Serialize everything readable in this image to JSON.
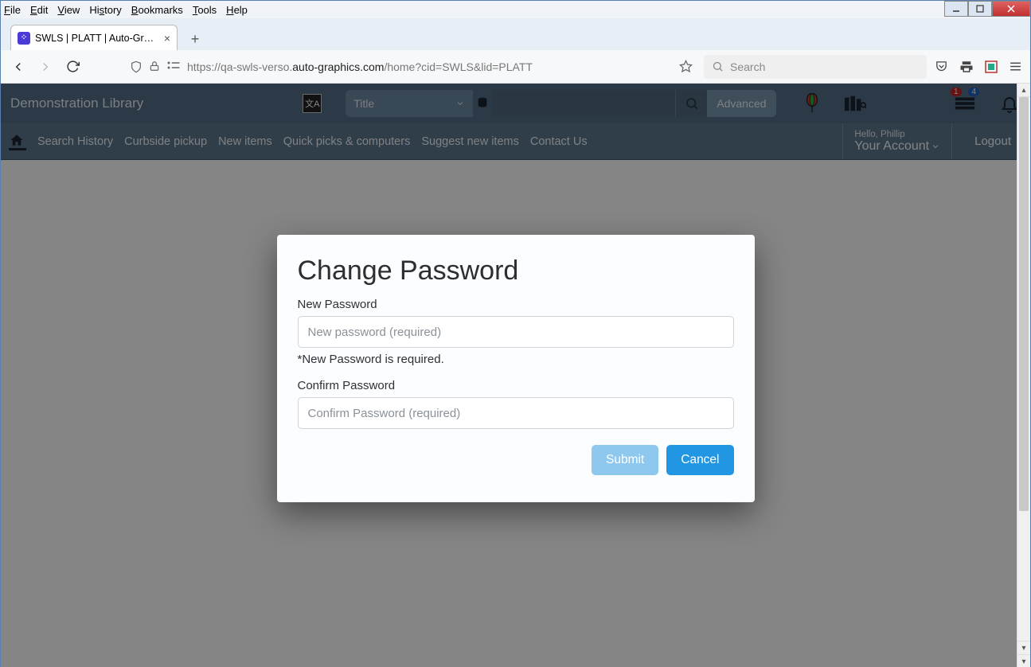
{
  "os_menu": [
    "File",
    "Edit",
    "View",
    "History",
    "Bookmarks",
    "Tools",
    "Help"
  ],
  "browser_tab": {
    "title": "SWLS | PLATT | Auto-Graphics In"
  },
  "url": {
    "prefix": "https://qa-swls-verso.",
    "domain": "auto-graphics.com",
    "path": "/home?cid=SWLS&lid=PLATT"
  },
  "browser_search_placeholder": "Search",
  "library": {
    "name": "Demonstration Library",
    "search_type": "Title",
    "advanced": "Advanced",
    "badge1": "1",
    "badge2": "4"
  },
  "nav": {
    "items": [
      "Search History",
      "Curbside pickup",
      "New items",
      "Quick picks & computers",
      "Suggest new items",
      "Contact Us"
    ],
    "hello": "Hello, Phillip",
    "account": "Your Account",
    "logout": "Logout"
  },
  "modal": {
    "title": "Change Password",
    "new_label": "New Password",
    "new_placeholder": "New password (required)",
    "error": "*New Password is required.",
    "confirm_label": "Confirm Password",
    "confirm_placeholder": "Confirm Password (required)",
    "submit": "Submit",
    "cancel": "Cancel"
  }
}
